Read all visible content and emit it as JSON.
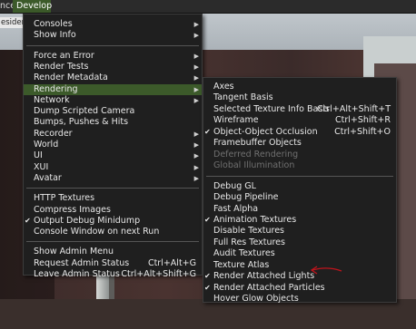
{
  "menubar": {
    "advanced_label": "nced",
    "develop_label": "Develop"
  },
  "background": {
    "field_text": "esider"
  },
  "develop_menu": {
    "groups": [
      [
        {
          "label": "Consoles",
          "submenu": true
        },
        {
          "label": "Show Info",
          "submenu": true
        }
      ],
      [
        {
          "label": "Force an Error",
          "submenu": true
        },
        {
          "label": "Render Tests",
          "submenu": true
        },
        {
          "label": "Render Metadata",
          "submenu": true
        },
        {
          "label": "Rendering",
          "submenu": true,
          "highlighted": true
        },
        {
          "label": "Network",
          "submenu": true
        },
        {
          "label": "Dump Scripted Camera"
        },
        {
          "label": "Bumps, Pushes & Hits"
        },
        {
          "label": "Recorder",
          "submenu": true
        },
        {
          "label": "World",
          "submenu": true
        },
        {
          "label": "UI",
          "submenu": true
        },
        {
          "label": "XUI",
          "submenu": true
        },
        {
          "label": "Avatar",
          "submenu": true
        }
      ],
      [
        {
          "label": "HTTP Textures"
        },
        {
          "label": "Compress Images"
        },
        {
          "label": "Output Debug Minidump",
          "checked": true
        },
        {
          "label": "Console Window on next Run"
        }
      ],
      [
        {
          "label": "Show Admin Menu"
        },
        {
          "label": "Request Admin Status",
          "shortcut": "Ctrl+Alt+G"
        },
        {
          "label": "Leave Admin Status",
          "shortcut": "Ctrl+Alt+Shift+G"
        }
      ]
    ]
  },
  "rendering_menu": {
    "groups": [
      [
        {
          "label": "Axes"
        },
        {
          "label": "Tangent Basis"
        },
        {
          "label": "Selected Texture Info Basis",
          "shortcut": "Ctrl+Alt+Shift+T"
        },
        {
          "label": "Wireframe",
          "shortcut": "Ctrl+Shift+R"
        },
        {
          "label": "Object-Object Occlusion",
          "shortcut": "Ctrl+Shift+O",
          "checked": true
        },
        {
          "label": "Framebuffer Objects"
        },
        {
          "label": "Deferred Rendering",
          "disabled": true
        },
        {
          "label": "Global Illumination",
          "disabled": true
        }
      ],
      [
        {
          "label": "Debug GL"
        },
        {
          "label": "Debug Pipeline"
        },
        {
          "label": "Fast Alpha"
        },
        {
          "label": "Animation Textures",
          "checked": true
        },
        {
          "label": "Disable Textures"
        },
        {
          "label": "Full Res Textures"
        },
        {
          "label": "Audit Textures"
        },
        {
          "label": "Texture Atlas"
        },
        {
          "label": "Render Attached Lights",
          "checked": true
        },
        {
          "label": "Render Attached Particles",
          "checked": true
        },
        {
          "label": "Hover Glow Objects"
        }
      ]
    ]
  },
  "colors": {
    "highlight": "#3c5a2a",
    "menu_bg": "#1f1f1f",
    "annotation": "#c0141c"
  },
  "glyphs": {
    "arrow": "▶",
    "check": "✔"
  }
}
